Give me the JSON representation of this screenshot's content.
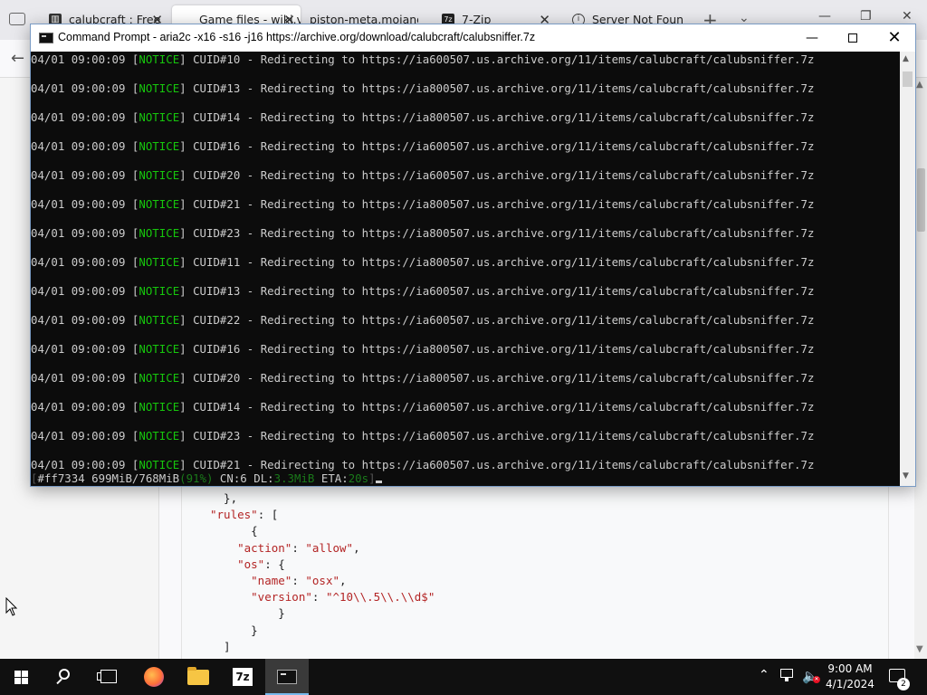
{
  "browser": {
    "tabs": [
      {
        "label": "calubcraft : Free",
        "active": false,
        "icon": "archive-icon"
      },
      {
        "label": "Game files - wiki.vg",
        "active": true,
        "icon": "wiki-icon"
      },
      {
        "label": "piston-meta.mojang",
        "active": false,
        "icon": "none"
      },
      {
        "label": "7-Zip",
        "active": false,
        "icon": "7zip-icon"
      },
      {
        "label": "Server Not Foun",
        "active": false,
        "icon": "info-icon"
      }
    ],
    "json_lines": [
      {
        "plain": "  },"
      },
      {
        "key": "\"rules\"",
        "plain": ": ["
      },
      {
        "plain": "    {"
      },
      {
        "key": "\"action\"",
        "mid": ": ",
        "val": "\"allow\"",
        "tail": ","
      },
      {
        "key": "\"os\"",
        "plain": ": {"
      },
      {
        "key": "\"name\"",
        "mid": ": ",
        "val": "\"osx\"",
        "tail": ","
      },
      {
        "key": "\"version\"",
        "mid": ": ",
        "val": "\"^10\\\\.5\\\\.\\\\d$\""
      },
      {
        "plain": "      }"
      },
      {
        "plain": "    }"
      },
      {
        "plain": "  ]"
      }
    ]
  },
  "cmd_window": {
    "title": "Command Prompt - aria2c  -x16 -s16 -j16 https://archive.org/download/calubcraft/calubsniffer.7z",
    "log_lines": [
      {
        "date": "04/01",
        "time": "09:00:09",
        "level": "NOTICE",
        "cuid": "CUID#10",
        "msg": "Redirecting to",
        "url": "https://ia600507.us.archive.org/11/items/calubcraft/calubsniffer.7z"
      },
      {
        "date": "04/01",
        "time": "09:00:09",
        "level": "NOTICE",
        "cuid": "CUID#13",
        "msg": "Redirecting to",
        "url": "https://ia800507.us.archive.org/11/items/calubcraft/calubsniffer.7z"
      },
      {
        "date": "04/01",
        "time": "09:00:09",
        "level": "NOTICE",
        "cuid": "CUID#14",
        "msg": "Redirecting to",
        "url": "https://ia800507.us.archive.org/11/items/calubcraft/calubsniffer.7z"
      },
      {
        "date": "04/01",
        "time": "09:00:09",
        "level": "NOTICE",
        "cuid": "CUID#16",
        "msg": "Redirecting to",
        "url": "https://ia600507.us.archive.org/11/items/calubcraft/calubsniffer.7z"
      },
      {
        "date": "04/01",
        "time": "09:00:09",
        "level": "NOTICE",
        "cuid": "CUID#20",
        "msg": "Redirecting to",
        "url": "https://ia600507.us.archive.org/11/items/calubcraft/calubsniffer.7z"
      },
      {
        "date": "04/01",
        "time": "09:00:09",
        "level": "NOTICE",
        "cuid": "CUID#21",
        "msg": "Redirecting to",
        "url": "https://ia800507.us.archive.org/11/items/calubcraft/calubsniffer.7z"
      },
      {
        "date": "04/01",
        "time": "09:00:09",
        "level": "NOTICE",
        "cuid": "CUID#23",
        "msg": "Redirecting to",
        "url": "https://ia800507.us.archive.org/11/items/calubcraft/calubsniffer.7z"
      },
      {
        "date": "04/01",
        "time": "09:00:09",
        "level": "NOTICE",
        "cuid": "CUID#11",
        "msg": "Redirecting to",
        "url": "https://ia800507.us.archive.org/11/items/calubcraft/calubsniffer.7z"
      },
      {
        "date": "04/01",
        "time": "09:00:09",
        "level": "NOTICE",
        "cuid": "CUID#13",
        "msg": "Redirecting to",
        "url": "https://ia600507.us.archive.org/11/items/calubcraft/calubsniffer.7z"
      },
      {
        "date": "04/01",
        "time": "09:00:09",
        "level": "NOTICE",
        "cuid": "CUID#22",
        "msg": "Redirecting to",
        "url": "https://ia600507.us.archive.org/11/items/calubcraft/calubsniffer.7z"
      },
      {
        "date": "04/01",
        "time": "09:00:09",
        "level": "NOTICE",
        "cuid": "CUID#16",
        "msg": "Redirecting to",
        "url": "https://ia800507.us.archive.org/11/items/calubcraft/calubsniffer.7z"
      },
      {
        "date": "04/01",
        "time": "09:00:09",
        "level": "NOTICE",
        "cuid": "CUID#20",
        "msg": "Redirecting to",
        "url": "https://ia800507.us.archive.org/11/items/calubcraft/calubsniffer.7z"
      },
      {
        "date": "04/01",
        "time": "09:00:09",
        "level": "NOTICE",
        "cuid": "CUID#14",
        "msg": "Redirecting to",
        "url": "https://ia600507.us.archive.org/11/items/calubcraft/calubsniffer.7z"
      },
      {
        "date": "04/01",
        "time": "09:00:09",
        "level": "NOTICE",
        "cuid": "CUID#23",
        "msg": "Redirecting to",
        "url": "https://ia600507.us.archive.org/11/items/calubcraft/calubsniffer.7z"
      },
      {
        "date": "04/01",
        "time": "09:00:09",
        "level": "NOTICE",
        "cuid": "CUID#21",
        "msg": "Redirecting to",
        "url": "https://ia600507.us.archive.org/11/items/calubcraft/calubsniffer.7z"
      }
    ],
    "status": {
      "gid": "#ff7334",
      "progress": "699MiB/768MiB",
      "percent": "(91%)",
      "cn": "CN:6",
      "dl_label": "DL:",
      "dl_value": "3.3MiB",
      "eta_label": "ETA:",
      "eta_value": "20s"
    }
  },
  "taskbar": {
    "time": "9:00 AM",
    "date": "4/1/2024",
    "notification_count": "2",
    "sevenzip_label": "7z",
    "pinned": [
      "start",
      "search",
      "task-view",
      "firefox",
      "file-explorer",
      "7-zip",
      "command-prompt"
    ]
  },
  "colors": {
    "notice": "#16c60c",
    "console_bg": "#0c0c0c",
    "console_text": "#cccccc",
    "json_string": "#b32424",
    "taskbar_bg": "#101010"
  }
}
